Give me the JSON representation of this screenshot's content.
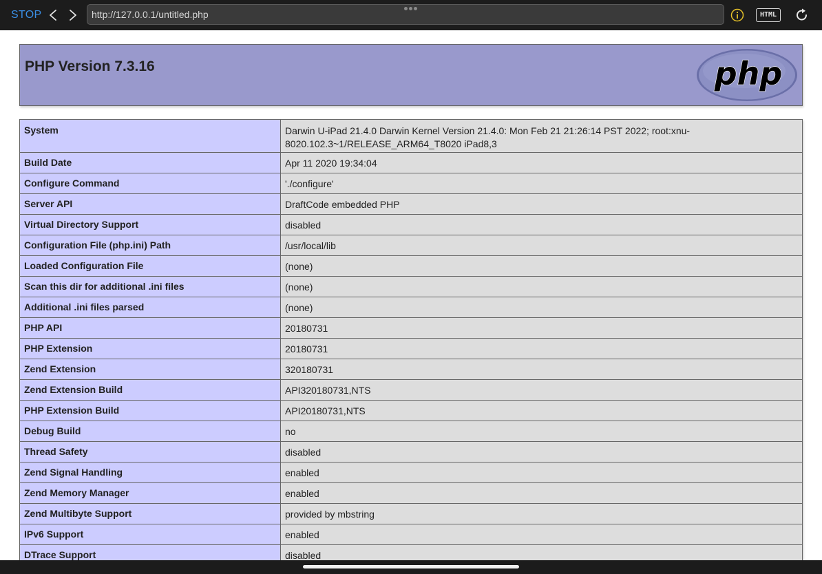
{
  "toolbar": {
    "stop_label": "STOP",
    "back_icon": "chevron-left-icon",
    "forward_icon": "chevron-right-icon",
    "url": "http://127.0.0.1/untitled.php",
    "more_icon": "ellipsis-icon",
    "info_icon": "info-icon",
    "html_label": "HTML",
    "reload_icon": "reload-icon",
    "accent_color": "#3a8fe6",
    "info_color": "#e6c229"
  },
  "header": {
    "title": "PHP Version 7.3.16",
    "logo_text": "php"
  },
  "rows": [
    {
      "key": "System",
      "value": "Darwin U-iPad 21.4.0 Darwin Kernel Version 21.4.0: Mon Feb 21 21:26:14 PST 2022; root:xnu-8020.102.3~1/RELEASE_ARM64_T8020 iPad8,3"
    },
    {
      "key": "Build Date",
      "value": "Apr 11 2020 19:34:04"
    },
    {
      "key": "Configure Command",
      "value": "'./configure'"
    },
    {
      "key": "Server API",
      "value": "DraftCode embedded PHP"
    },
    {
      "key": "Virtual Directory Support",
      "value": "disabled"
    },
    {
      "key": "Configuration File (php.ini) Path",
      "value": "/usr/local/lib"
    },
    {
      "key": "Loaded Configuration File",
      "value": "(none)"
    },
    {
      "key": "Scan this dir for additional .ini files",
      "value": "(none)"
    },
    {
      "key": "Additional .ini files parsed",
      "value": "(none)"
    },
    {
      "key": "PHP API",
      "value": "20180731"
    },
    {
      "key": "PHP Extension",
      "value": "20180731"
    },
    {
      "key": "Zend Extension",
      "value": "320180731"
    },
    {
      "key": "Zend Extension Build",
      "value": "API320180731,NTS"
    },
    {
      "key": "PHP Extension Build",
      "value": "API20180731,NTS"
    },
    {
      "key": "Debug Build",
      "value": "no"
    },
    {
      "key": "Thread Safety",
      "value": "disabled"
    },
    {
      "key": "Zend Signal Handling",
      "value": "enabled"
    },
    {
      "key": "Zend Memory Manager",
      "value": "enabled"
    },
    {
      "key": "Zend Multibyte Support",
      "value": "provided by mbstring"
    },
    {
      "key": "IPv6 Support",
      "value": "enabled"
    },
    {
      "key": "DTrace Support",
      "value": "disabled"
    }
  ]
}
